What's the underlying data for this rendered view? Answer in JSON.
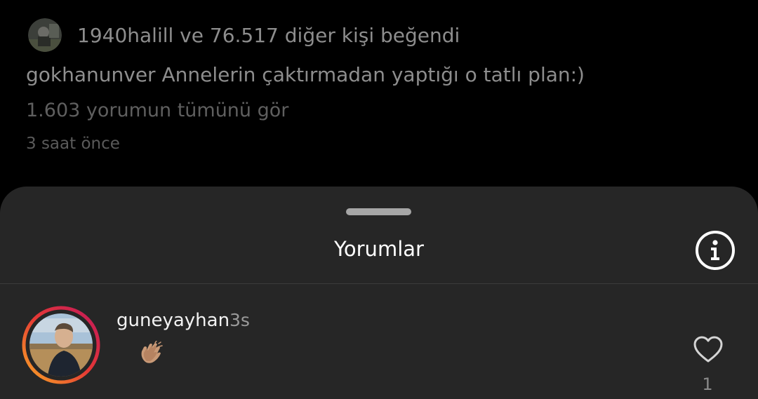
{
  "post": {
    "likes_user": "1940halill",
    "likes_connector": " ve ",
    "likes_count": "76.517",
    "likes_suffix": " diğer kişi beğendi",
    "caption_user": "gokhanunver",
    "caption_text": " Annelerin çaktırmadan yaptığı o tatlı plan:)",
    "view_all_comments": "1.603 yorumun tümünü gör",
    "time_ago": "3 saat önce"
  },
  "sheet": {
    "title": "Yorumlar",
    "info_icon": "info-circle-icon"
  },
  "comments": [
    {
      "username": "guneyayhan",
      "time": "3s",
      "text_emoji": "clapping-hands-emoji",
      "like_count": "1",
      "has_story_ring": true
    }
  ],
  "colors": {
    "background": "#000000",
    "sheet": "#262626",
    "story_ring_start": "#f9a825",
    "story_ring_end": "#c2185b"
  }
}
